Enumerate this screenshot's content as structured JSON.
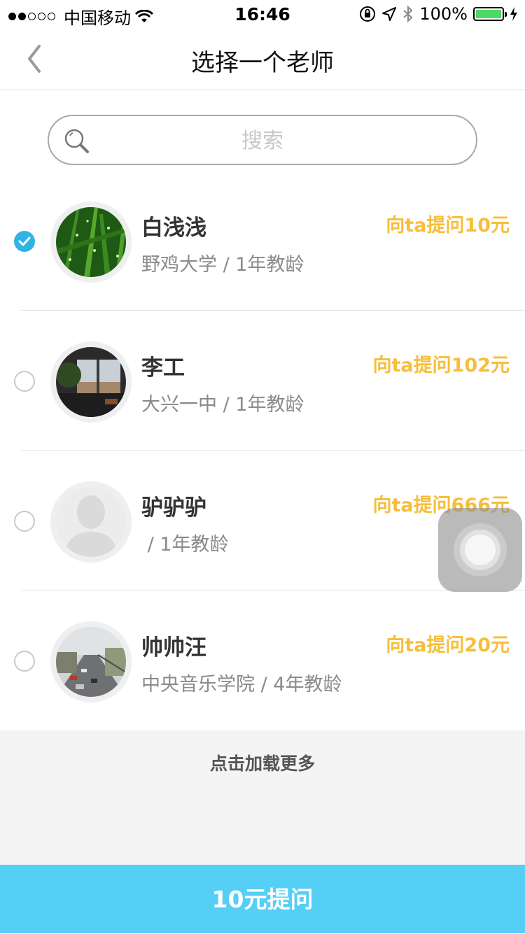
{
  "status_bar": {
    "carrier": "中国移动",
    "time": "16:46",
    "battery": "100%"
  },
  "nav": {
    "title": "选择一个老师"
  },
  "search": {
    "placeholder": "搜索",
    "value": ""
  },
  "teachers": [
    {
      "name": "白浅浅",
      "info": "野鸡大学 / 1年教龄",
      "price": "向ta提问10元",
      "selected": true,
      "avatar": "grass-photo-avatar"
    },
    {
      "name": "李工",
      "info": "大兴一中 / 1年教龄",
      "price": "向ta提问102元",
      "selected": false,
      "avatar": "window-photo-avatar"
    },
    {
      "name": "驴驴驴",
      "info": " / 1年教龄",
      "price": "向ta提问666元",
      "selected": false,
      "avatar": "default-person-avatar"
    },
    {
      "name": "帅帅汪",
      "info": "中央音乐学院 / 4年教龄",
      "price": "向ta提问20元",
      "selected": false,
      "avatar": "street-photo-avatar"
    }
  ],
  "load_more": "点击加载更多",
  "action": {
    "ask_label": "10元提问"
  },
  "colors": {
    "accent": "#31b3e6",
    "price": "#f7be3a",
    "button": "#56cff6"
  }
}
